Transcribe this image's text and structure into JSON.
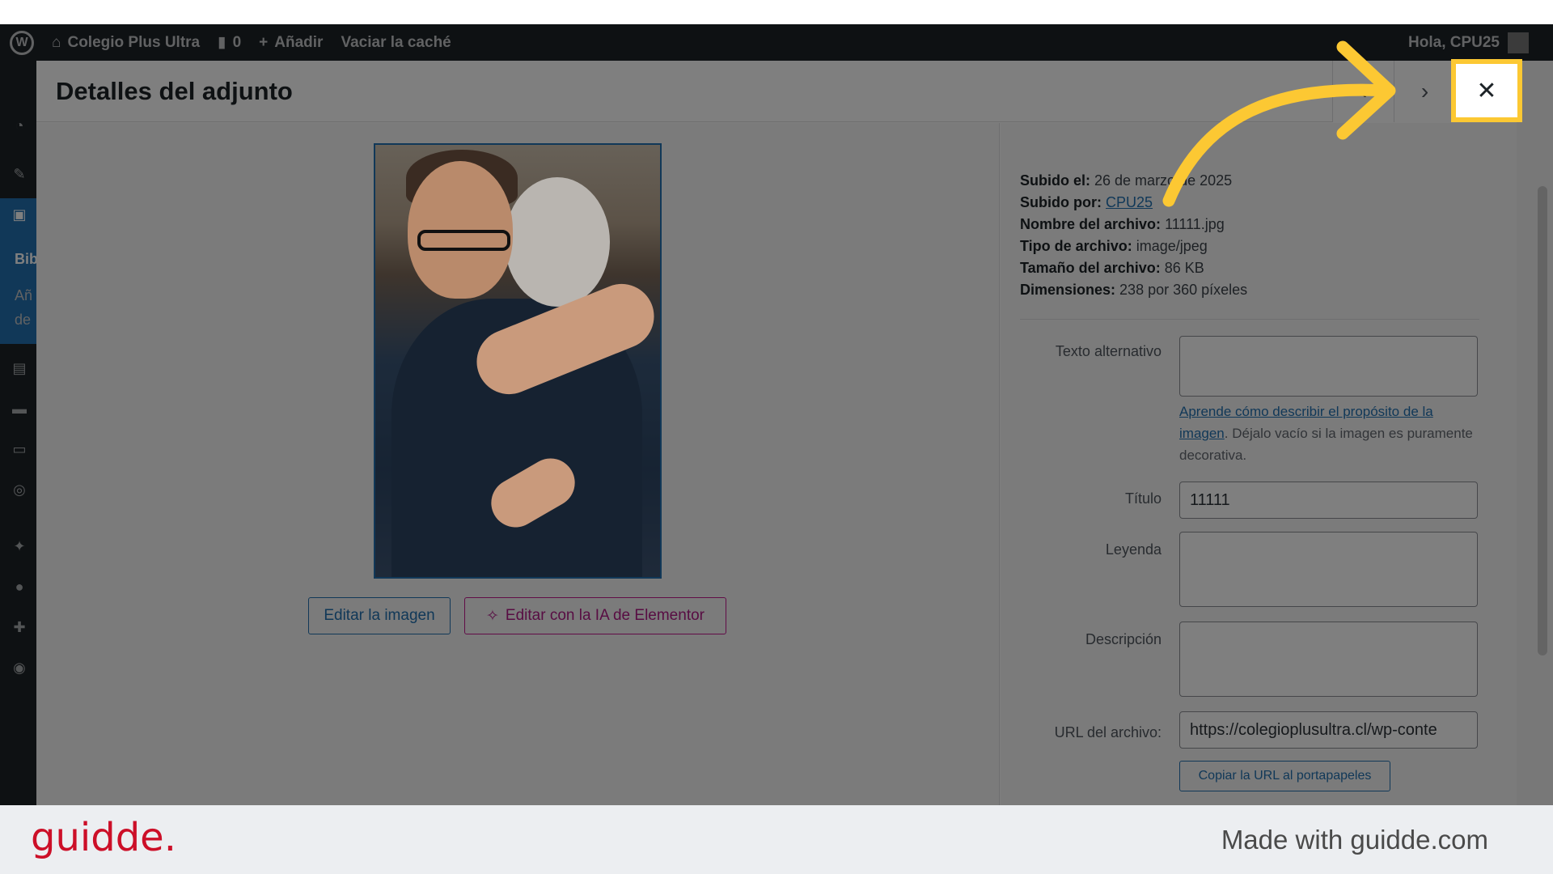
{
  "adminbar": {
    "wp_logo": "W",
    "site_name": "Colegio Plus Ultra",
    "comments_count": "0",
    "add_new": "Añadir",
    "clear_cache": "Vaciar la caché",
    "greeting": "Hola, CPU25"
  },
  "adminmenu": {
    "section_title": "Bib",
    "sub_1": "Añ",
    "sub_2": "de"
  },
  "modal": {
    "title": "Detalles del adjunto",
    "prev_glyph": "‹",
    "next_glyph": "›",
    "close_glyph": "✕"
  },
  "media": {
    "edit_image_label": "Editar la imagen",
    "edit_ai_label": "Editar con la IA de Elementor",
    "ai_glyph": "✧"
  },
  "details": {
    "uploaded_on_label": "Subido el:",
    "uploaded_on_value": "26 de marzo de 2025",
    "uploaded_by_label": "Subido por:",
    "uploaded_by_value": "CPU25",
    "file_name_label": "Nombre del archivo:",
    "file_name_value": "11111.jpg",
    "file_type_label": "Tipo de archivo:",
    "file_type_value": "image/jpeg",
    "file_size_label": "Tamaño del archivo:",
    "file_size_value": "86 KB",
    "dimensions_label": "Dimensiones:",
    "dimensions_value": "238 por 360 píxeles"
  },
  "fields": {
    "alt_label": "Texto alternativo",
    "alt_value": "",
    "alt_help_link": "Aprende cómo describir el propósito de la imagen",
    "alt_help_text": ". Déjalo vacío si la imagen es puramente decorativa.",
    "title_label": "Título",
    "title_value": "11111",
    "caption_label": "Leyenda",
    "caption_value": "",
    "description_label": "Descripción",
    "description_value": "",
    "url_label": "URL del archivo:",
    "url_value": "https://colegioplusultra.cl/wp-conte",
    "copy_url_label": "Copiar la URL al portapapeles"
  },
  "footer": {
    "brand": "guidde.",
    "made_with": "Made with guidde.com"
  },
  "colors": {
    "highlight": "#fcc833",
    "wp_blue": "#2271b1",
    "elementor_pink": "#b01b87",
    "brand_red": "#cc0f28"
  }
}
